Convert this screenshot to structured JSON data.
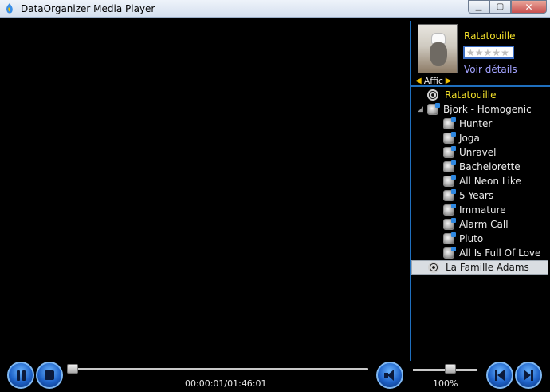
{
  "window": {
    "title": "DataOrganizer Media Player",
    "minimize_glyph": "▁",
    "maximize_glyph": "▢",
    "close_glyph": "✕"
  },
  "movie": {
    "title": "Ratatouille",
    "rating_stars": 0,
    "rating_max": 5,
    "details_link": "Voir détails",
    "poster_nav_label": "Affiche"
  },
  "playlist": [
    {
      "label": "Ratatouille",
      "icon": "film-reel-icon",
      "level": 0,
      "highlight": "yellow"
    },
    {
      "label": "Bjork - Homogenic",
      "icon": "album-icon",
      "level": 0,
      "expanded": true
    },
    {
      "label": "Hunter",
      "icon": "track-icon",
      "level": 1
    },
    {
      "label": "Joga",
      "icon": "track-icon",
      "level": 1
    },
    {
      "label": "Unravel",
      "icon": "track-icon",
      "level": 1
    },
    {
      "label": "Bachelorette",
      "icon": "track-icon",
      "level": 1
    },
    {
      "label": "All Neon Like",
      "icon": "track-icon",
      "level": 1
    },
    {
      "label": "5 Years",
      "icon": "track-icon",
      "level": 1
    },
    {
      "label": "Immature",
      "icon": "track-icon",
      "level": 1
    },
    {
      "label": "Alarm Call",
      "icon": "track-icon",
      "level": 1
    },
    {
      "label": "Pluto",
      "icon": "track-icon",
      "level": 1
    },
    {
      "label": "All Is Full Of Love",
      "icon": "track-icon",
      "level": 1
    },
    {
      "label": "La Famille Adams",
      "icon": "film-reel-icon",
      "level": 0,
      "selected": true
    }
  ],
  "controls": {
    "time": "00:00:01/01:46:01",
    "seek_fraction": 0.0,
    "volume_label": "100%",
    "volume_fraction": 1.0
  },
  "colors": {
    "accent_blue": "#1f6fbe",
    "title_yellow": "#f3e12a",
    "link": "#a3a3ff"
  }
}
